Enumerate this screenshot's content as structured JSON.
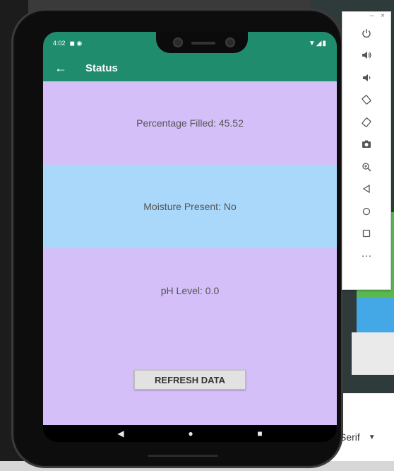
{
  "status_bar": {
    "time": "4:02",
    "left_icons": "◼ ◉",
    "right_icons": "▼◢▮"
  },
  "app_bar": {
    "back_icon": "arrow-left-icon",
    "title": "Status"
  },
  "sections": {
    "percentage_filled": "Percentage Filled: 45.52",
    "moisture_present": "Moisture Present: No",
    "ph_level": "pH Level: 0.0"
  },
  "refresh_button": {
    "label": "REFRESH DATA"
  },
  "nav_bar": {
    "back": "◀",
    "home": "●",
    "recents": "■"
  },
  "toolbar": {
    "minimize": "–",
    "close": "×",
    "items": [
      "power",
      "volume-up",
      "volume-down",
      "rotate-left",
      "rotate-right",
      "camera",
      "zoom",
      "back",
      "home",
      "overview",
      "more"
    ],
    "more_label": "···"
  },
  "font_select": {
    "value": "Serif"
  },
  "colors": {
    "app_bar": "#1f8c6e",
    "section_purple": "#d4bff8",
    "section_blue": "#a9d8fb"
  }
}
